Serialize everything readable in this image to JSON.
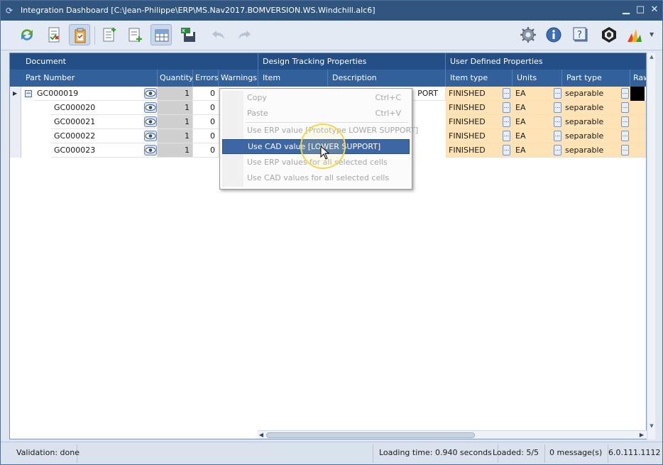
{
  "window": {
    "title": "Integration Dashboard [C:\\Jean-Philippe\\ERP\\MS.Nav2017.BOMVERSION.WS.Windchill.alc6]",
    "controls": [
      "minimize",
      "maximize",
      "close"
    ]
  },
  "toolbar": {
    "icons": [
      "refresh-icon",
      "validate-list-icon",
      "clipboard-icon",
      "new-document-icon",
      "add-document-icon",
      "grid-view-icon",
      "export-xlsx-icon",
      "undo-icon",
      "redo-icon",
      "settings-icon",
      "info-icon",
      "help-icon",
      "erp-logo-icon",
      "chart-logo-icon"
    ]
  },
  "grid": {
    "groups": [
      "Document",
      "Design Tracking Properties",
      "User Defined Properties"
    ],
    "columns": [
      "Part Number",
      "Quantity",
      "Errors",
      "Warnings",
      "Item",
      "Description",
      "Item type",
      "Units",
      "Part type",
      "Raw"
    ],
    "rows": [
      {
        "part_number": "GC000019",
        "quantity": "1",
        "errors": "0",
        "description_tail": "PORT",
        "item_type": "FINISHED",
        "units": "EA",
        "part_type": "separable"
      },
      {
        "part_number": "GC000020",
        "quantity": "1",
        "errors": "0",
        "description_tail": "",
        "item_type": "FINISHED",
        "units": "EA",
        "part_type": "separable"
      },
      {
        "part_number": "GC000021",
        "quantity": "1",
        "errors": "0",
        "description_tail": "",
        "item_type": "FINISHED",
        "units": "EA",
        "part_type": "separable"
      },
      {
        "part_number": "GC000022",
        "quantity": "1",
        "errors": "0",
        "description_tail": "",
        "item_type": "FINISHED",
        "units": "EA",
        "part_type": "separable"
      },
      {
        "part_number": "GC000023",
        "quantity": "1",
        "errors": "0",
        "description_tail": "",
        "item_type": "FINISHED",
        "units": "EA",
        "part_type": "separable"
      }
    ],
    "ellipsis": "..."
  },
  "context_menu": {
    "items": [
      {
        "label": "Copy",
        "shortcut": "Ctrl+C",
        "enabled": false
      },
      {
        "label": "Paste",
        "shortcut": "Ctrl+V",
        "enabled": false
      },
      {
        "label": "Use ERP value [Prototype LOWER SUPPORT]",
        "shortcut": "",
        "enabled": false
      },
      {
        "label": "Use CAD value [LOWER SUPPORT]",
        "shortcut": "",
        "enabled": true
      },
      {
        "label": "Use ERP values for all selected cells",
        "shortcut": "",
        "enabled": false
      },
      {
        "label": "Use CAD values for all selected cells",
        "shortcut": "",
        "enabled": false
      }
    ]
  },
  "status": {
    "validation": "Validation: done",
    "loading_time": "Loading time: 0.940 seconds",
    "loaded": "Loaded: 5/5",
    "messages": "0 message(s)",
    "version": "6.0.111.1112"
  },
  "colors": {
    "title_bar": "#305680",
    "group_header": "#244f86",
    "column_header": "#31609b",
    "user_defined_cell": "#fde3b5",
    "menu_highlight": "#3c67a4",
    "cursor_halo": "#f2d84a"
  }
}
